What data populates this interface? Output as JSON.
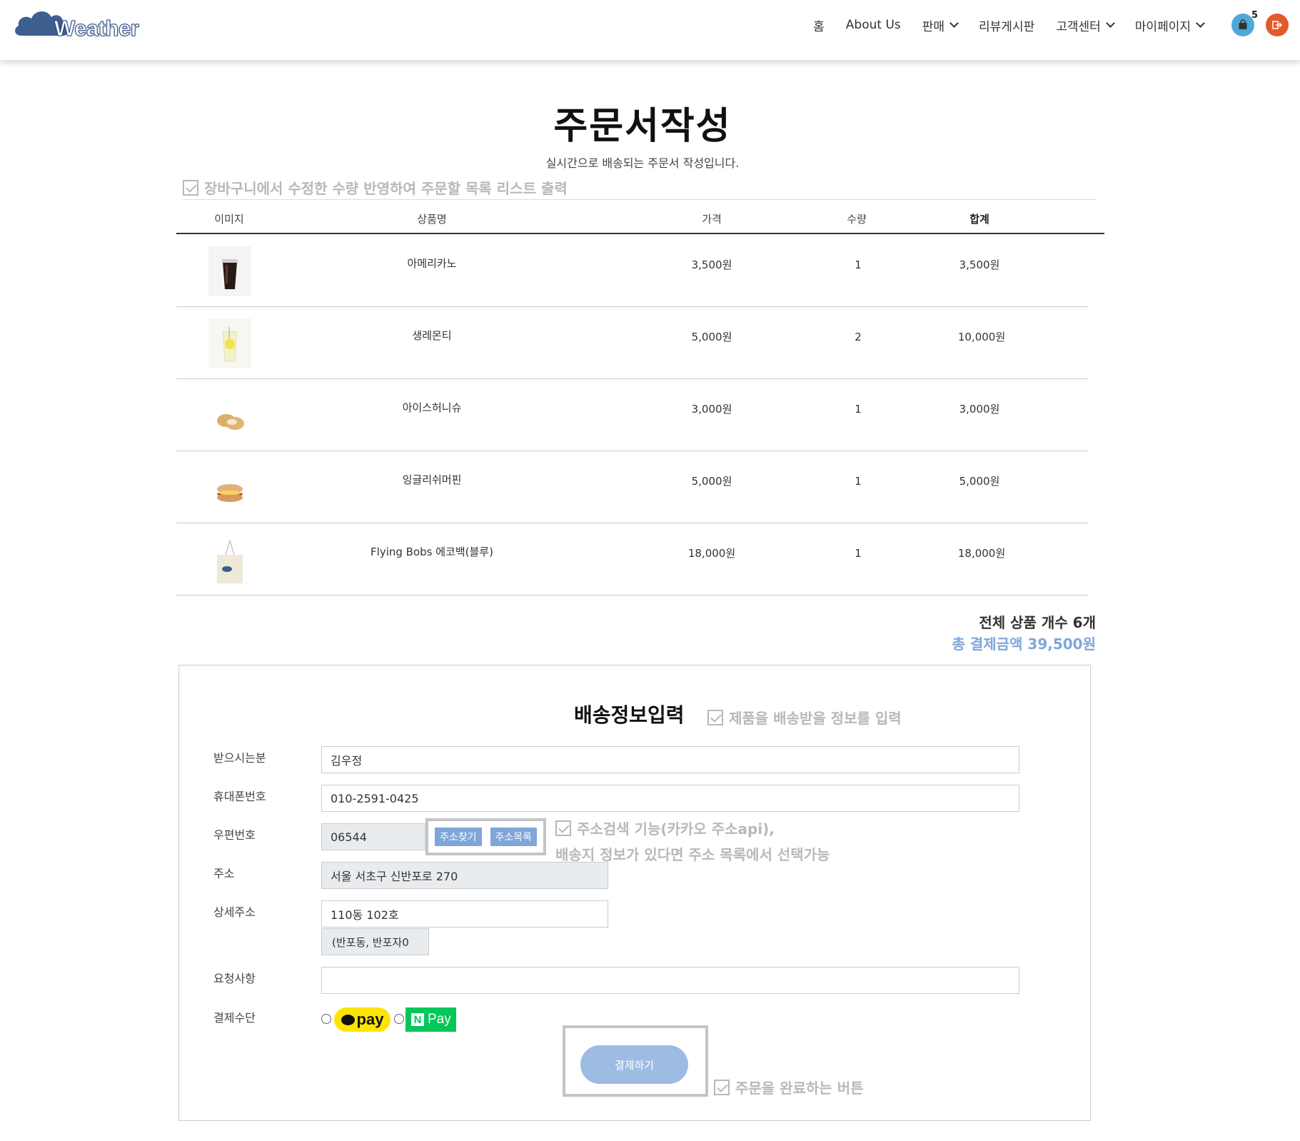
{
  "nav": {
    "logo_text": "Weather",
    "items": [
      {
        "label": "홈",
        "dropdown": false
      },
      {
        "label": "About Us",
        "dropdown": false
      },
      {
        "label": "판매",
        "dropdown": true
      },
      {
        "label": "리뷰게시판",
        "dropdown": false
      },
      {
        "label": "고객센터",
        "dropdown": true
      },
      {
        "label": "마이페이지",
        "dropdown": true
      }
    ],
    "cart_count": "5",
    "cart_icon": "shopping-bag-icon",
    "logout_icon": "logout-icon",
    "colors": {
      "cart": "#4fa8d8",
      "logout": "#e25a28",
      "brand": "#3d5f8f"
    }
  },
  "page": {
    "title": "주문서작성",
    "subtitle": "실시간으로 배송되는 주문서 작성입니다.",
    "note_list": "장바구니에서 수정한 수량 반영하여 주문할 목록 리스트 출력"
  },
  "table": {
    "headers": {
      "image": "이미지",
      "name": "상품명",
      "price": "가격",
      "qty": "수량",
      "subtotal": "합계"
    },
    "rows": [
      {
        "name": "아메리카노",
        "price": "3,500원",
        "qty": "1",
        "subtotal": "3,500원",
        "image": "iced-americano"
      },
      {
        "name": "생레몬티",
        "price": "5,000원",
        "qty": "2",
        "subtotal": "10,000원",
        "image": "lemon-tea"
      },
      {
        "name": "아이스허니슈",
        "price": "3,000원",
        "qty": "1",
        "subtotal": "3,000원",
        "image": "honey-choux"
      },
      {
        "name": "잉글리쉬머핀",
        "price": "5,000원",
        "qty": "1",
        "subtotal": "5,000원",
        "image": "english-muffin"
      },
      {
        "name": "Flying Bobs 에코백(블루)",
        "price": "18,000원",
        "qty": "1",
        "subtotal": "18,000원",
        "image": "eco-bag"
      }
    ]
  },
  "summary": {
    "total_count": "전체 상품 개수 6개",
    "total_amount": "총 결제금액 39,500원",
    "accent": "#7fa6d8"
  },
  "shipping": {
    "title": "배송정보입력",
    "note": "제품을 배송받을 정보를 입력",
    "labels": {
      "recipient": "받으시는분",
      "phone": "휴대폰번호",
      "zip": "우편번호",
      "address": "주소",
      "detail": "상세주소",
      "request": "요청사항",
      "payment": "결제수단"
    },
    "values": {
      "recipient": "김우정",
      "phone": "010-2591-0425",
      "zip": "06544",
      "address": "서울 서초구 신반포로 270",
      "detail": "110동 102호",
      "extra": "(반포동, 반포자0",
      "request": ""
    },
    "buttons": {
      "find_address": "주소찾기",
      "address_list": "주소목록"
    },
    "note_address_1": "주소검색 기능(카카오 주소api),",
    "note_address_2": "배송지 정보가 있다면 주소 목록에서 선택가능",
    "payment_options": {
      "kakao": "pay",
      "naver": "Pay",
      "naver_mark": "N"
    },
    "pay_button": "결제하기",
    "note_pay": "주문을 완료하는 버튼"
  }
}
